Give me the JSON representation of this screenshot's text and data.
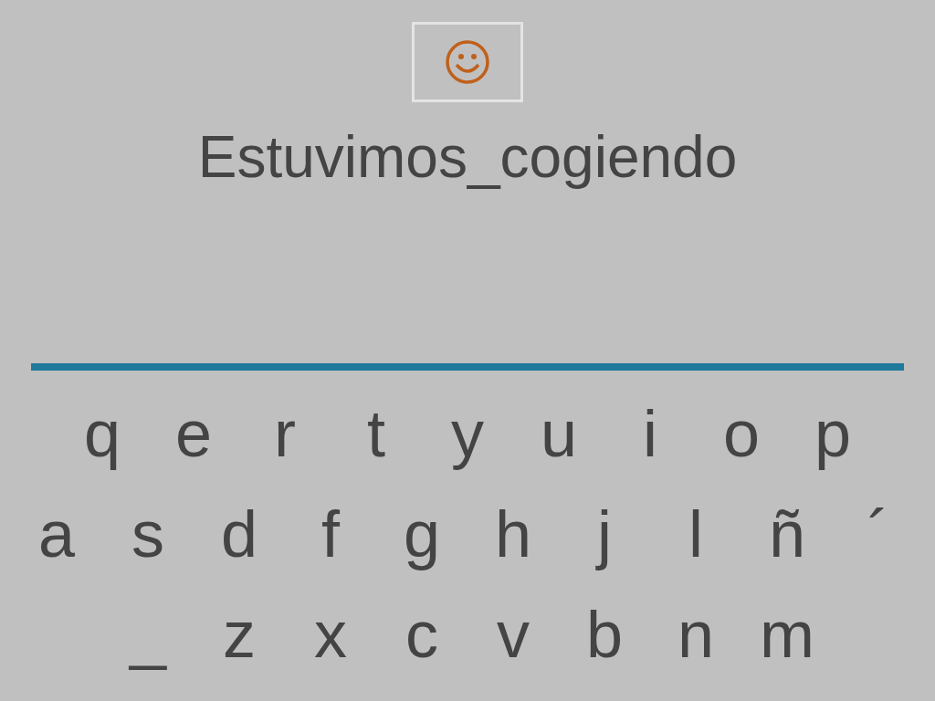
{
  "word": "Estuvimos_cogiendo",
  "keyboard": {
    "rows": [
      {
        "keys": [
          "q",
          "e",
          "r",
          "t",
          "y",
          "u",
          "i",
          "o",
          "p"
        ]
      },
      {
        "keys": [
          "a",
          "s",
          "d",
          "f",
          "g",
          "h",
          "j",
          "l",
          "ñ",
          "´"
        ]
      },
      {
        "keys": [
          "_",
          "z",
          "x",
          "c",
          "v",
          "b",
          "n",
          "m"
        ]
      }
    ]
  }
}
